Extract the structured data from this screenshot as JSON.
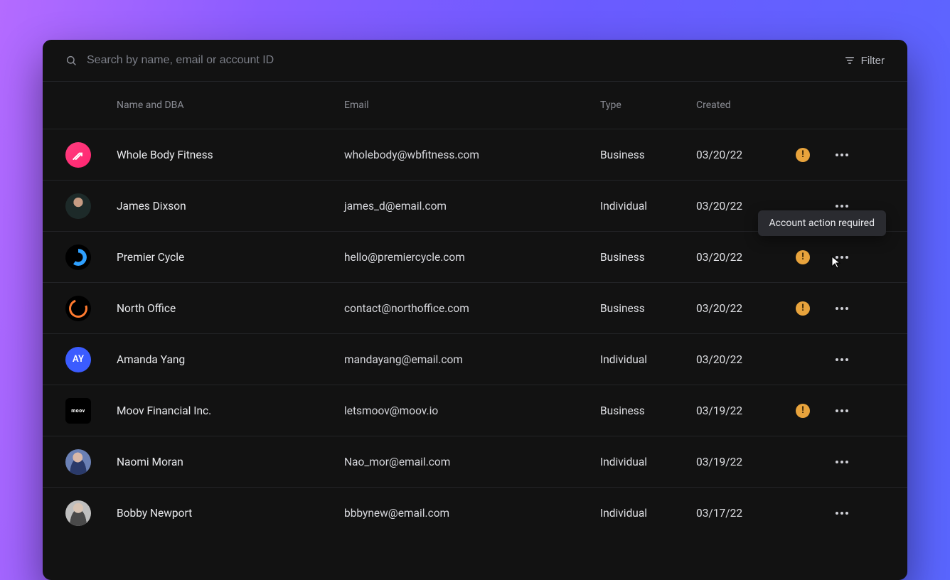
{
  "search": {
    "placeholder": "Search by name, email or account ID"
  },
  "filter_label": "Filter",
  "columns": {
    "name": "Name and DBA",
    "email": "Email",
    "type": "Type",
    "created": "Created"
  },
  "tooltip_text": "Account action required",
  "rows": [
    {
      "name": "Whole Body Fitness",
      "email": "wholebody@wbfitness.com",
      "type": "Business",
      "created": "03/20/22",
      "warn": true,
      "avatar": "pink-arrow",
      "initials": ""
    },
    {
      "name": "James Dixson",
      "email": "james_d@email.com",
      "type": "Individual",
      "created": "03/20/22",
      "warn": false,
      "avatar": "photo",
      "initials": ""
    },
    {
      "name": "Premier Cycle",
      "email": "hello@premiercycle.com",
      "type": "Business",
      "created": "03/20/22",
      "warn": true,
      "avatar": "blue-p",
      "initials": "",
      "show_tooltip": true
    },
    {
      "name": "North Office",
      "email": "contact@northoffice.com",
      "type": "Business",
      "created": "03/20/22",
      "warn": true,
      "avatar": "orange-n",
      "initials": ""
    },
    {
      "name": "Amanda Yang",
      "email": "mandayang@email.com",
      "type": "Individual",
      "created": "03/20/22",
      "warn": false,
      "avatar": "indigo",
      "initials": "AY"
    },
    {
      "name": "Moov Financial Inc.",
      "email": "letsmoov@moov.io",
      "type": "Business",
      "created": "03/19/22",
      "warn": true,
      "avatar": "moov",
      "initials": "moov"
    },
    {
      "name": "Naomi Moran",
      "email": "Nao_mor@email.com",
      "type": "Individual",
      "created": "03/19/22",
      "warn": false,
      "avatar": "naomi",
      "initials": ""
    },
    {
      "name": "Bobby Newport",
      "email": "bbbynew@email.com",
      "type": "Individual",
      "created": "03/17/22",
      "warn": false,
      "avatar": "bobby",
      "initials": ""
    }
  ]
}
